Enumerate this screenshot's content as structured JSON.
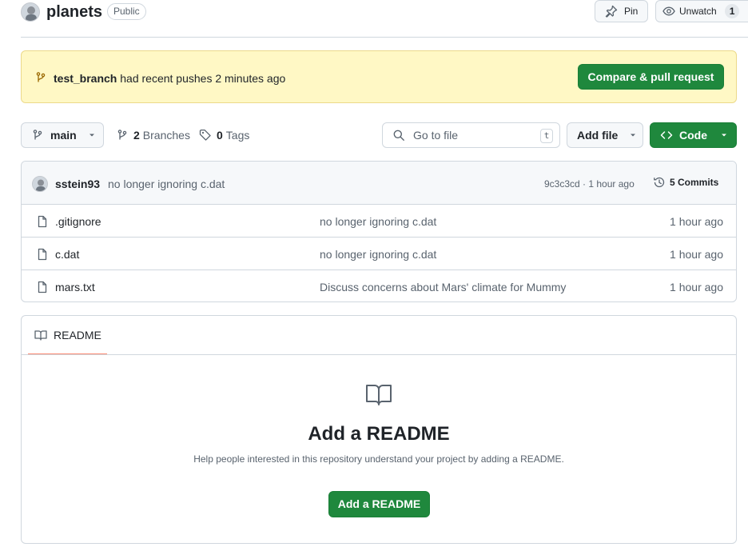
{
  "header": {
    "repo_name": "planets",
    "visibility_badge": "Public",
    "pin_label": "Pin",
    "watch_label": "Unwatch",
    "watch_count": "1"
  },
  "banner": {
    "branch": "test_branch",
    "message": "had recent pushes 2 minutes ago",
    "compare_label": "Compare & pull request"
  },
  "toolbar": {
    "branch_label": "main",
    "branches_count": "2",
    "branches_label": "Branches",
    "tags_count": "0",
    "tags_label": "Tags",
    "goto_placeholder": "Go to file",
    "goto_shortcut": "t",
    "add_file_label": "Add file",
    "code_label": "Code"
  },
  "latest_commit": {
    "author": "sstein93",
    "message": "no longer ignoring c.dat",
    "meta": "9c3c3cd · 1 hour ago",
    "commits_label": "5 Commits"
  },
  "files": [
    {
      "name": ".gitignore",
      "message": "no longer ignoring c.dat",
      "time": "1 hour ago"
    },
    {
      "name": "c.dat",
      "message": "no longer ignoring c.dat",
      "time": "1 hour ago"
    },
    {
      "name": "mars.txt",
      "message": "Discuss concerns about Mars' climate for Mummy",
      "time": "1 hour ago"
    }
  ],
  "readme": {
    "tab_label": "README",
    "title": "Add a README",
    "subtitle": "Help people interested in this repository understand your project by adding a README.",
    "button_label": "Add a README"
  },
  "colors": {
    "primary_green": "#1f883d",
    "banner_bg": "#fff8c5",
    "tab_underline": "#fd8c73"
  }
}
